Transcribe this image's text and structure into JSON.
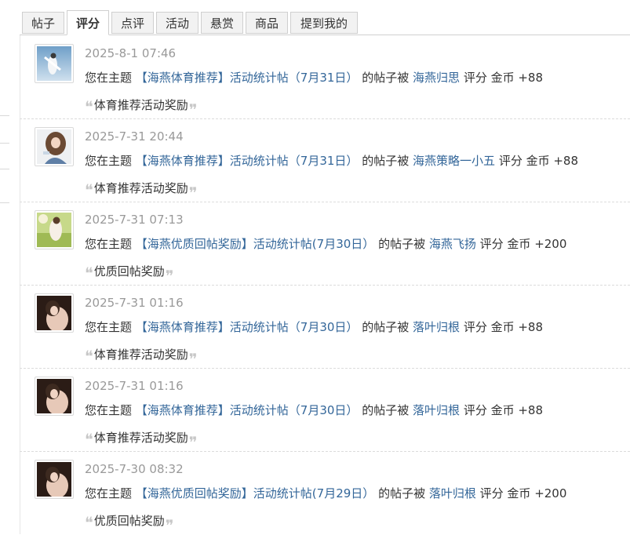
{
  "tabs": [
    {
      "label": "帖子",
      "active": false
    },
    {
      "label": "评分",
      "active": true
    },
    {
      "label": "点评",
      "active": false
    },
    {
      "label": "活动",
      "active": false
    },
    {
      "label": "悬赏",
      "active": false
    },
    {
      "label": "商品",
      "active": false
    },
    {
      "label": "提到我的",
      "active": false
    }
  ],
  "items": [
    {
      "time": "2025-8-1 07:46",
      "prefix": "您在主题",
      "thread": "【海燕体育推荐】活动统计帖（7月31日）",
      "middle": "的帖子被",
      "user": "海燕归思",
      "suffix": "评分 金币 +88",
      "reason": "体育推荐活动奖励",
      "avatar": "avatar-sky-figure"
    },
    {
      "time": "2025-7-31 20:44",
      "prefix": "您在主题",
      "thread": "【海燕体育推荐】活动统计帖（7月31日）",
      "middle": "的帖子被",
      "user": "海燕策略一小五",
      "suffix": "评分 金币 +88",
      "reason": "体育推荐活动奖励",
      "avatar": "avatar-girl-curly"
    },
    {
      "time": "2025-7-31 07:13",
      "prefix": "您在主题",
      "thread": "【海燕优质回帖奖励】活动统计帖(7月30日）",
      "middle": "的帖子被",
      "user": "海燕飞扬",
      "suffix": "评分 金币 +200",
      "reason": "优质回帖奖励",
      "avatar": "avatar-field-figure"
    },
    {
      "time": "2025-7-31 01:16",
      "prefix": "您在主题",
      "thread": "【海燕体育推荐】活动统计帖（7月30日）",
      "middle": "的帖子被",
      "user": "落叶归根",
      "suffix": "评分 金币 +88",
      "reason": "体育推荐活动奖励",
      "avatar": "avatar-dark-portrait"
    },
    {
      "time": "2025-7-31 01:16",
      "prefix": "您在主题",
      "thread": "【海燕体育推荐】活动统计帖（7月30日）",
      "middle": "的帖子被",
      "user": "落叶归根",
      "suffix": "评分 金币 +88",
      "reason": "体育推荐活动奖励",
      "avatar": "avatar-dark-portrait"
    },
    {
      "time": "2025-7-30 08:32",
      "prefix": "您在主题",
      "thread": "【海燕优质回帖奖励】活动统计帖(7月29日）",
      "middle": "的帖子被",
      "user": "落叶归根",
      "suffix": "评分 金币 +200",
      "reason": "优质回帖奖励",
      "avatar": "avatar-dark-portrait"
    }
  ],
  "quote_open": "❝",
  "quote_close": "❞",
  "colors": {
    "link": "#336699",
    "muted": "#999999",
    "text": "#333333",
    "border": "#cfcfcf"
  }
}
